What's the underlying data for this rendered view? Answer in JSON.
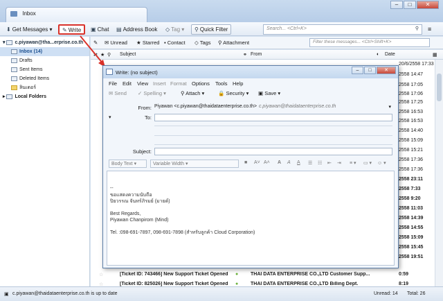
{
  "window": {
    "tab_title": "Inbox",
    "min_icon": "–",
    "max_icon": "□",
    "close_icon": "✕"
  },
  "toolbar": {
    "get_messages": "Get Messages",
    "write": "Write",
    "chat": "Chat",
    "address_book": "Address Book",
    "tag": "Tag",
    "quick_filter": "Quick Filter",
    "search_placeholder": "Search... <Ctrl+K>"
  },
  "folders": {
    "account": "c.piyawan@tha...erprise.co.th",
    "items": [
      {
        "label": "Inbox (14)"
      },
      {
        "label": "Drafts"
      },
      {
        "label": "Sent Items"
      },
      {
        "label": "Deleted Items"
      },
      {
        "label": "ลินเดอร์"
      }
    ],
    "local": "Local Folders"
  },
  "filterbar": {
    "unread": "Unread",
    "starred": "Starred",
    "contact": "Contact",
    "tags": "Tags",
    "attachment": "Attachment",
    "filter_placeholder": "Filter these messages... <Ctrl+Shift+K>"
  },
  "columns": {
    "subject": "Subject",
    "from": "From",
    "date": "Date"
  },
  "visible_dates": [
    "20/6/2558 17:33",
    "2558 14:47",
    "2558 17:05",
    "2558 17:06",
    "2558 17:25",
    "2558 16:53",
    "2558 16:53",
    "2558 14:40",
    "2558 15:09",
    "2558 15:21",
    "2558 17:36",
    "2558 17:36",
    "2558 23:11",
    "2558 7:33",
    "2558 9:20",
    "2558 11:03",
    "2558 14:39",
    "2558 14:55",
    "2558 15:09",
    "2558 15:45",
    "2558 19:51"
  ],
  "messages": [
    {
      "subject": "[Ticket ID: 743466] New Support Ticket Opened",
      "from": "THAI DATA ENTERPRISE CO.,LTD Customer Supp...",
      "date": "0:59"
    },
    {
      "subject": "[Ticket ID: 825026] New Support Ticket Opened",
      "from": "THAI DATA ENTERPRISE CO.,LTD Billing Dept.",
      "date": "8:19"
    }
  ],
  "status": {
    "left": "c.piyawan@thaidataenterprise.co.th is up to date",
    "unread": "Unread: 14",
    "total": "Total: 26"
  },
  "compose": {
    "title": "Write: (no subject)",
    "menu": [
      "File",
      "Edit",
      "View",
      "Insert",
      "Format",
      "Options",
      "Tools",
      "Help"
    ],
    "send": "Send",
    "spelling": "Spelling",
    "attach": "Attach",
    "security": "Security",
    "save": "Save",
    "from_label": "From:",
    "from_name": "Piyawan <c.piyawan@thaidataenterprise.co.th>",
    "from_hint": "c.piyawan@thaidataenterprise.co.th",
    "to_label": "To:",
    "subject_label": "Subject:",
    "body_text_select": "Body Text",
    "width_select": "Variable Width",
    "body_lines": [
      "--",
      "ขอแสดงความนับถือ",
      "ปิยวรรณ จันทร์ภิรมย์ (มายด์)",
      "",
      "Best Regards,",
      "Piyawan Chanpirom (Mind)",
      "",
      "Tel. :098-691-7897, 098-691-7898 (สำหรับลูกค้า Cloud Corporation)"
    ]
  }
}
